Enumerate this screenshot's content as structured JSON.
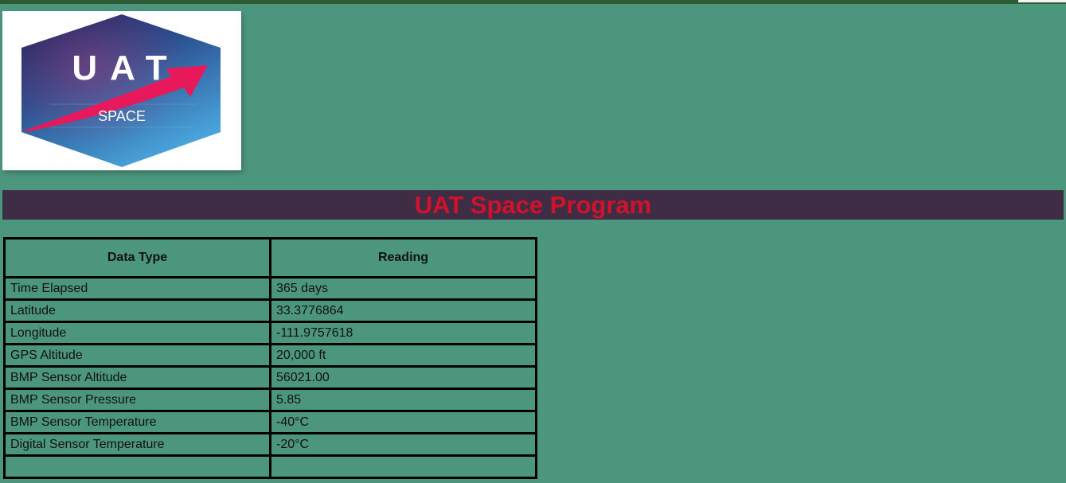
{
  "logo": {
    "main_text": "UAT",
    "sub_text": "SPACE"
  },
  "banner": {
    "title": "UAT Space Program"
  },
  "table": {
    "headers": [
      "Data Type",
      "Reading"
    ],
    "rows": [
      [
        "Time Elapsed",
        "365 days"
      ],
      [
        "Latitude",
        "33.3776864"
      ],
      [
        "Longitude",
        "-111.9757618"
      ],
      [
        "GPS Altitude",
        "20,000 ft"
      ],
      [
        "BMP Sensor Altitude",
        "56021.00"
      ],
      [
        "BMP Sensor Pressure",
        "5.85"
      ],
      [
        "BMP Sensor Temperature",
        "-40°C"
      ],
      [
        "Digital Sensor Temperature",
        "-20°C"
      ],
      [
        "",
        ""
      ]
    ]
  },
  "colors": {
    "page_background": "#4d967e",
    "banner_background": "#3f2c45",
    "title_text": "#d0122a",
    "logo_arrow": "#e8195a"
  }
}
